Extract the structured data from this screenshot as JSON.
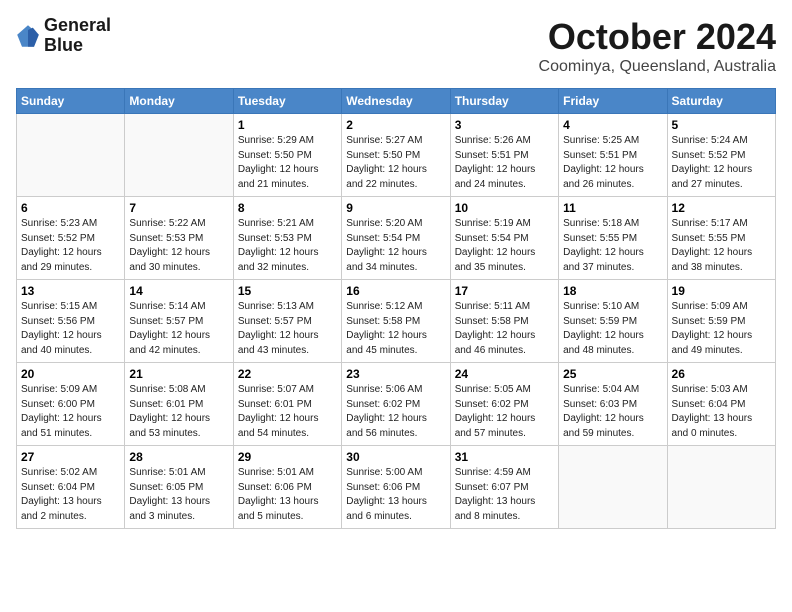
{
  "logo": {
    "line1": "General",
    "line2": "Blue"
  },
  "title": "October 2024",
  "location": "Coominya, Queensland, Australia",
  "headers": [
    "Sunday",
    "Monday",
    "Tuesday",
    "Wednesday",
    "Thursday",
    "Friday",
    "Saturday"
  ],
  "weeks": [
    [
      {
        "day": "",
        "detail": ""
      },
      {
        "day": "",
        "detail": ""
      },
      {
        "day": "1",
        "detail": "Sunrise: 5:29 AM\nSunset: 5:50 PM\nDaylight: 12 hours\nand 21 minutes."
      },
      {
        "day": "2",
        "detail": "Sunrise: 5:27 AM\nSunset: 5:50 PM\nDaylight: 12 hours\nand 22 minutes."
      },
      {
        "day": "3",
        "detail": "Sunrise: 5:26 AM\nSunset: 5:51 PM\nDaylight: 12 hours\nand 24 minutes."
      },
      {
        "day": "4",
        "detail": "Sunrise: 5:25 AM\nSunset: 5:51 PM\nDaylight: 12 hours\nand 26 minutes."
      },
      {
        "day": "5",
        "detail": "Sunrise: 5:24 AM\nSunset: 5:52 PM\nDaylight: 12 hours\nand 27 minutes."
      }
    ],
    [
      {
        "day": "6",
        "detail": "Sunrise: 5:23 AM\nSunset: 5:52 PM\nDaylight: 12 hours\nand 29 minutes."
      },
      {
        "day": "7",
        "detail": "Sunrise: 5:22 AM\nSunset: 5:53 PM\nDaylight: 12 hours\nand 30 minutes."
      },
      {
        "day": "8",
        "detail": "Sunrise: 5:21 AM\nSunset: 5:53 PM\nDaylight: 12 hours\nand 32 minutes."
      },
      {
        "day": "9",
        "detail": "Sunrise: 5:20 AM\nSunset: 5:54 PM\nDaylight: 12 hours\nand 34 minutes."
      },
      {
        "day": "10",
        "detail": "Sunrise: 5:19 AM\nSunset: 5:54 PM\nDaylight: 12 hours\nand 35 minutes."
      },
      {
        "day": "11",
        "detail": "Sunrise: 5:18 AM\nSunset: 5:55 PM\nDaylight: 12 hours\nand 37 minutes."
      },
      {
        "day": "12",
        "detail": "Sunrise: 5:17 AM\nSunset: 5:55 PM\nDaylight: 12 hours\nand 38 minutes."
      }
    ],
    [
      {
        "day": "13",
        "detail": "Sunrise: 5:15 AM\nSunset: 5:56 PM\nDaylight: 12 hours\nand 40 minutes."
      },
      {
        "day": "14",
        "detail": "Sunrise: 5:14 AM\nSunset: 5:57 PM\nDaylight: 12 hours\nand 42 minutes."
      },
      {
        "day": "15",
        "detail": "Sunrise: 5:13 AM\nSunset: 5:57 PM\nDaylight: 12 hours\nand 43 minutes."
      },
      {
        "day": "16",
        "detail": "Sunrise: 5:12 AM\nSunset: 5:58 PM\nDaylight: 12 hours\nand 45 minutes."
      },
      {
        "day": "17",
        "detail": "Sunrise: 5:11 AM\nSunset: 5:58 PM\nDaylight: 12 hours\nand 46 minutes."
      },
      {
        "day": "18",
        "detail": "Sunrise: 5:10 AM\nSunset: 5:59 PM\nDaylight: 12 hours\nand 48 minutes."
      },
      {
        "day": "19",
        "detail": "Sunrise: 5:09 AM\nSunset: 5:59 PM\nDaylight: 12 hours\nand 49 minutes."
      }
    ],
    [
      {
        "day": "20",
        "detail": "Sunrise: 5:09 AM\nSunset: 6:00 PM\nDaylight: 12 hours\nand 51 minutes."
      },
      {
        "day": "21",
        "detail": "Sunrise: 5:08 AM\nSunset: 6:01 PM\nDaylight: 12 hours\nand 53 minutes."
      },
      {
        "day": "22",
        "detail": "Sunrise: 5:07 AM\nSunset: 6:01 PM\nDaylight: 12 hours\nand 54 minutes."
      },
      {
        "day": "23",
        "detail": "Sunrise: 5:06 AM\nSunset: 6:02 PM\nDaylight: 12 hours\nand 56 minutes."
      },
      {
        "day": "24",
        "detail": "Sunrise: 5:05 AM\nSunset: 6:02 PM\nDaylight: 12 hours\nand 57 minutes."
      },
      {
        "day": "25",
        "detail": "Sunrise: 5:04 AM\nSunset: 6:03 PM\nDaylight: 12 hours\nand 59 minutes."
      },
      {
        "day": "26",
        "detail": "Sunrise: 5:03 AM\nSunset: 6:04 PM\nDaylight: 13 hours\nand 0 minutes."
      }
    ],
    [
      {
        "day": "27",
        "detail": "Sunrise: 5:02 AM\nSunset: 6:04 PM\nDaylight: 13 hours\nand 2 minutes."
      },
      {
        "day": "28",
        "detail": "Sunrise: 5:01 AM\nSunset: 6:05 PM\nDaylight: 13 hours\nand 3 minutes."
      },
      {
        "day": "29",
        "detail": "Sunrise: 5:01 AM\nSunset: 6:06 PM\nDaylight: 13 hours\nand 5 minutes."
      },
      {
        "day": "30",
        "detail": "Sunrise: 5:00 AM\nSunset: 6:06 PM\nDaylight: 13 hours\nand 6 minutes."
      },
      {
        "day": "31",
        "detail": "Sunrise: 4:59 AM\nSunset: 6:07 PM\nDaylight: 13 hours\nand 8 minutes."
      },
      {
        "day": "",
        "detail": ""
      },
      {
        "day": "",
        "detail": ""
      }
    ]
  ]
}
